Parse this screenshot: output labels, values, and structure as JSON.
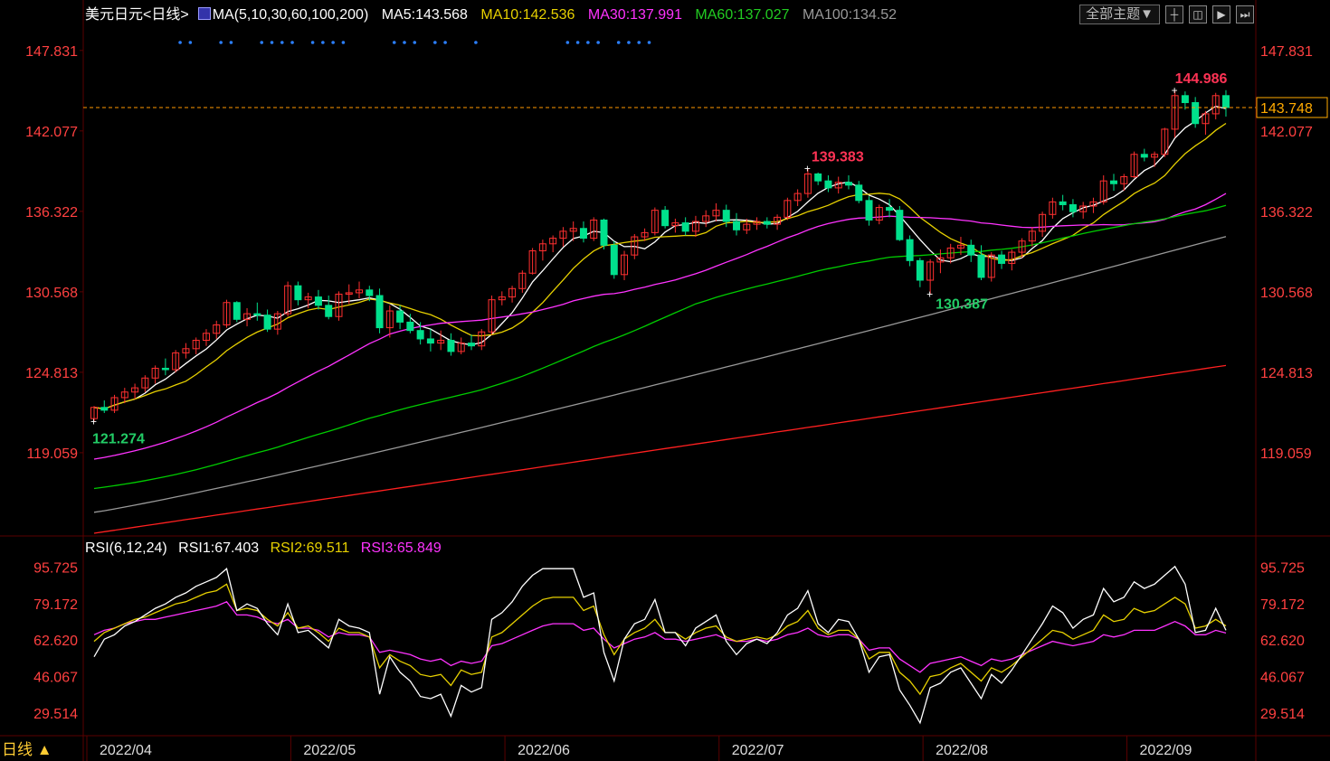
{
  "header": {
    "symbol": "美元日元<日线>",
    "ma_icon": "ma-indicator-icon",
    "ma_spec": "MA(5,10,30,60,100,200)",
    "ma5": "MA5:143.568",
    "ma10": "MA10:142.536",
    "ma30": "MA30:137.991",
    "ma60": "MA60:137.027",
    "ma100": "MA100:134.52"
  },
  "toolbar": {
    "theme_label": "全部主题▼",
    "buttons": [
      "grid-icon",
      "layout-icon",
      "play-icon",
      "next-icon"
    ]
  },
  "price_axis": {
    "ticks": [
      "147.831",
      "142.077",
      "136.322",
      "130.568",
      "124.813",
      "119.059"
    ],
    "last_price": "143.748"
  },
  "annotations": {
    "high": "144.986",
    "mid_high": "139.383",
    "low": "130.387",
    "start_low": "121.274"
  },
  "rsi_header": {
    "spec": "RSI(6,12,24)",
    "rsi1": "RSI1:67.403",
    "rsi2": "RSI2:69.511",
    "rsi3": "RSI3:65.849"
  },
  "rsi_axis": {
    "ticks": [
      "95.725",
      "79.172",
      "62.620",
      "46.067",
      "29.514"
    ]
  },
  "time_axis": {
    "labels": [
      "2022/04",
      "2022/05",
      "2022/06",
      "2022/07",
      "2022/08",
      "2022/09"
    ]
  },
  "period_label": "日线 ▲",
  "colors": {
    "up": "#ff3030",
    "down": "#00e08c",
    "ma5": "#ffffff",
    "ma10": "#e6d000",
    "ma30": "#ff33ff",
    "ma60": "#00cc00",
    "ma100": "#999999",
    "ma200": "#ff2020",
    "axis_text": "#ff4040",
    "grid": "#5a0000"
  },
  "chart_data": {
    "type": "candlestick",
    "price_range": [
      113.3,
      149.5
    ],
    "rsi_range": [
      20,
      100
    ],
    "month_starts": [
      "2022/04",
      "2022/05",
      "2022/06",
      "2022/07",
      "2022/08",
      "2022/09"
    ],
    "candles": [
      [
        121.5,
        122.4,
        121.27,
        122.3
      ],
      [
        122.3,
        122.8,
        121.9,
        122.1
      ],
      [
        122.1,
        123.2,
        121.9,
        123.0
      ],
      [
        123.0,
        123.7,
        122.6,
        123.4
      ],
      [
        123.4,
        124.0,
        122.9,
        123.7
      ],
      [
        123.7,
        124.6,
        123.4,
        124.4
      ],
      [
        124.4,
        125.3,
        124.0,
        125.1
      ],
      [
        125.1,
        125.8,
        124.6,
        125.0
      ],
      [
        125.0,
        126.4,
        124.8,
        126.2
      ],
      [
        126.2,
        126.9,
        125.8,
        126.5
      ],
      [
        126.5,
        127.3,
        126.1,
        127.1
      ],
      [
        127.1,
        127.9,
        126.7,
        127.6
      ],
      [
        127.6,
        128.5,
        127.2,
        128.2
      ],
      [
        128.2,
        130.0,
        128.0,
        129.8
      ],
      [
        129.8,
        129.9,
        128.4,
        128.6
      ],
      [
        128.6,
        129.4,
        128.1,
        129.0
      ],
      [
        129.0,
        129.8,
        128.5,
        128.9
      ],
      [
        128.9,
        129.3,
        127.7,
        127.9
      ],
      [
        127.9,
        129.2,
        127.5,
        129.0
      ],
      [
        129.0,
        131.3,
        128.8,
        131.0
      ],
      [
        131.0,
        131.3,
        129.6,
        130.0
      ],
      [
        130.0,
        130.5,
        129.4,
        130.2
      ],
      [
        130.2,
        130.7,
        129.3,
        129.6
      ],
      [
        129.6,
        130.3,
        128.6,
        128.8
      ],
      [
        128.8,
        130.6,
        128.5,
        130.4
      ],
      [
        130.4,
        131.1,
        129.7,
        130.5
      ],
      [
        130.5,
        131.3,
        130.1,
        130.7
      ],
      [
        130.7,
        131.0,
        129.9,
        130.3
      ],
      [
        130.3,
        130.8,
        127.6,
        128.0
      ],
      [
        128.0,
        129.6,
        127.3,
        129.2
      ],
      [
        129.2,
        129.6,
        127.9,
        128.4
      ],
      [
        128.4,
        129.0,
        127.6,
        127.8
      ],
      [
        127.8,
        128.4,
        126.8,
        127.2
      ],
      [
        127.2,
        127.9,
        126.3,
        126.9
      ],
      [
        126.9,
        127.8,
        126.4,
        127.1
      ],
      [
        127.1,
        127.6,
        126.0,
        126.3
      ],
      [
        126.3,
        127.3,
        126.1,
        126.9
      ],
      [
        126.9,
        127.5,
        126.4,
        126.7
      ],
      [
        126.7,
        127.9,
        126.4,
        127.7
      ],
      [
        127.7,
        130.3,
        127.5,
        130.0
      ],
      [
        130.0,
        130.6,
        129.6,
        130.2
      ],
      [
        130.2,
        131.0,
        129.8,
        130.8
      ],
      [
        130.8,
        132.1,
        130.5,
        131.9
      ],
      [
        131.9,
        133.7,
        131.8,
        133.5
      ],
      [
        133.5,
        134.3,
        132.8,
        134.0
      ],
      [
        134.0,
        134.6,
        133.4,
        134.4
      ],
      [
        134.4,
        135.2,
        133.8,
        134.9
      ],
      [
        134.9,
        135.6,
        134.2,
        135.1
      ],
      [
        135.1,
        135.6,
        134.1,
        134.4
      ],
      [
        134.4,
        135.9,
        134.2,
        135.7
      ],
      [
        135.7,
        135.8,
        133.6,
        133.9
      ],
      [
        133.9,
        134.2,
        131.5,
        131.8
      ],
      [
        131.8,
        133.5,
        131.4,
        133.2
      ],
      [
        133.2,
        134.7,
        132.9,
        134.5
      ],
      [
        134.5,
        135.1,
        134.2,
        134.8
      ],
      [
        134.8,
        136.6,
        134.6,
        136.4
      ],
      [
        136.4,
        136.7,
        135.1,
        135.3
      ],
      [
        135.3,
        135.8,
        134.8,
        135.5
      ],
      [
        135.5,
        135.9,
        134.6,
        134.9
      ],
      [
        134.9,
        136.0,
        134.5,
        135.6
      ],
      [
        135.6,
        136.4,
        135.2,
        136.0
      ],
      [
        136.0,
        136.9,
        135.6,
        136.4
      ],
      [
        136.4,
        136.8,
        135.2,
        135.6
      ],
      [
        135.6,
        136.2,
        134.6,
        135.0
      ],
      [
        135.0,
        135.8,
        134.7,
        135.4
      ],
      [
        135.4,
        135.9,
        135.0,
        135.6
      ],
      [
        135.6,
        135.9,
        135.1,
        135.4
      ],
      [
        135.4,
        136.1,
        135.0,
        135.9
      ],
      [
        135.9,
        137.3,
        135.7,
        137.1
      ],
      [
        137.1,
        137.9,
        136.7,
        137.6
      ],
      [
        137.6,
        139.38,
        137.3,
        139.0
      ],
      [
        139.0,
        139.1,
        138.2,
        138.5
      ],
      [
        138.5,
        138.9,
        137.7,
        138.0
      ],
      [
        138.0,
        138.8,
        137.6,
        138.4
      ],
      [
        138.4,
        138.9,
        137.9,
        138.2
      ],
      [
        138.2,
        138.5,
        136.9,
        137.1
      ],
      [
        137.1,
        137.4,
        135.3,
        135.7
      ],
      [
        135.7,
        136.8,
        135.4,
        136.6
      ],
      [
        136.6,
        137.2,
        135.9,
        136.4
      ],
      [
        136.4,
        136.7,
        134.2,
        134.3
      ],
      [
        134.3,
        134.6,
        132.4,
        132.8
      ],
      [
        132.8,
        133.0,
        130.9,
        131.4
      ],
      [
        131.4,
        132.9,
        130.387,
        132.7
      ],
      [
        132.7,
        133.6,
        131.9,
        133.0
      ],
      [
        133.0,
        134.0,
        132.6,
        133.7
      ],
      [
        133.7,
        134.5,
        133.2,
        133.9
      ],
      [
        133.9,
        134.3,
        132.7,
        133.2
      ],
      [
        133.2,
        133.9,
        131.4,
        131.6
      ],
      [
        131.6,
        133.4,
        131.3,
        133.2
      ],
      [
        133.2,
        133.5,
        132.2,
        132.6
      ],
      [
        132.6,
        133.6,
        132.1,
        133.4
      ],
      [
        133.4,
        134.4,
        133.0,
        134.2
      ],
      [
        134.2,
        135.2,
        133.8,
        134.9
      ],
      [
        134.9,
        136.3,
        134.5,
        136.1
      ],
      [
        136.1,
        137.3,
        135.8,
        137.0
      ],
      [
        137.0,
        137.5,
        136.4,
        136.8
      ],
      [
        136.8,
        137.2,
        135.9,
        136.3
      ],
      [
        136.3,
        137.0,
        135.8,
        136.7
      ],
      [
        136.7,
        137.3,
        136.2,
        137.0
      ],
      [
        137.0,
        138.9,
        136.8,
        138.5
      ],
      [
        138.5,
        139.0,
        137.8,
        138.3
      ],
      [
        138.3,
        139.0,
        137.8,
        138.8
      ],
      [
        138.8,
        140.6,
        138.7,
        140.4
      ],
      [
        140.4,
        140.8,
        139.9,
        140.2
      ],
      [
        140.2,
        140.6,
        139.5,
        140.4
      ],
      [
        140.4,
        142.3,
        140.2,
        142.2
      ],
      [
        142.2,
        144.99,
        141.6,
        144.6
      ],
      [
        144.6,
        144.9,
        143.6,
        144.1
      ],
      [
        144.1,
        144.5,
        142.3,
        142.6
      ],
      [
        142.6,
        143.5,
        141.8,
        143.3
      ],
      [
        143.3,
        144.8,
        142.9,
        144.6
      ],
      [
        144.6,
        144.99,
        143.1,
        143.75
      ]
    ],
    "ma100_end": 134.52,
    "ma200_start": 113.3,
    "ma200_end": 125.3,
    "rsi1": [
      55,
      63,
      65,
      69,
      71,
      74,
      77,
      79,
      82,
      84,
      87,
      89,
      91,
      95,
      76,
      79,
      77,
      70,
      65,
      79,
      66,
      67,
      63,
      59,
      72,
      69,
      68,
      66,
      38,
      55,
      48,
      44,
      37,
      36,
      38,
      28,
      42,
      39,
      41,
      72,
      75,
      80,
      87,
      92,
      95,
      95,
      95,
      95,
      82,
      84,
      57,
      44,
      63,
      70,
      72,
      81,
      66,
      66,
      60,
      68,
      71,
      74,
      62,
      56,
      61,
      63,
      61,
      66,
      74,
      77,
      85,
      70,
      66,
      72,
      71,
      63,
      48,
      55,
      56,
      40,
      33,
      25,
      41,
      43,
      48,
      50,
      43,
      36,
      47,
      43,
      49,
      56,
      63,
      70,
      78,
      75,
      68,
      72,
      74,
      86,
      80,
      82,
      89,
      86,
      88,
      92,
      96,
      88,
      66,
      67,
      77,
      67
    ],
    "rsi2": [
      62,
      66,
      68,
      70,
      72,
      73,
      75,
      77,
      79,
      80,
      82,
      84,
      85,
      88,
      76,
      77,
      76,
      72,
      69,
      75,
      68,
      69,
      66,
      62,
      68,
      66,
      66,
      64,
      50,
      56,
      53,
      51,
      47,
      46,
      47,
      42,
      49,
      47,
      48,
      64,
      66,
      70,
      74,
      78,
      81,
      82,
      82,
      82,
      76,
      78,
      65,
      56,
      63,
      66,
      68,
      72,
      66,
      66,
      63,
      66,
      68,
      69,
      64,
      62,
      63,
      64,
      63,
      65,
      69,
      71,
      76,
      68,
      65,
      67,
      67,
      63,
      54,
      57,
      57,
      48,
      44,
      38,
      46,
      47,
      50,
      52,
      48,
      44,
      50,
      48,
      51,
      55,
      59,
      63,
      67,
      66,
      63,
      65,
      67,
      74,
      71,
      72,
      77,
      75,
      76,
      79,
      82,
      79,
      68,
      69,
      72,
      69
    ],
    "rsi3": [
      65,
      67,
      68,
      70,
      71,
      72,
      72,
      73,
      74,
      75,
      76,
      77,
      78,
      80,
      74,
      74,
      73,
      71,
      70,
      72,
      68,
      68,
      67,
      64,
      66,
      65,
      65,
      64,
      57,
      58,
      57,
      56,
      54,
      53,
      54,
      51,
      53,
      52,
      53,
      60,
      61,
      63,
      65,
      67,
      69,
      70,
      70,
      70,
      67,
      68,
      63,
      59,
      61,
      63,
      64,
      66,
      63,
      63,
      62,
      63,
      64,
      65,
      63,
      62,
      62,
      63,
      62,
      63,
      65,
      66,
      68,
      65,
      64,
      65,
      65,
      63,
      58,
      59,
      59,
      54,
      51,
      48,
      52,
      53,
      54,
      55,
      53,
      51,
      54,
      53,
      54,
      56,
      58,
      60,
      62,
      61,
      60,
      61,
      62,
      65,
      64,
      65,
      67,
      67,
      67,
      69,
      71,
      69,
      65,
      65,
      67,
      65.8
    ]
  }
}
